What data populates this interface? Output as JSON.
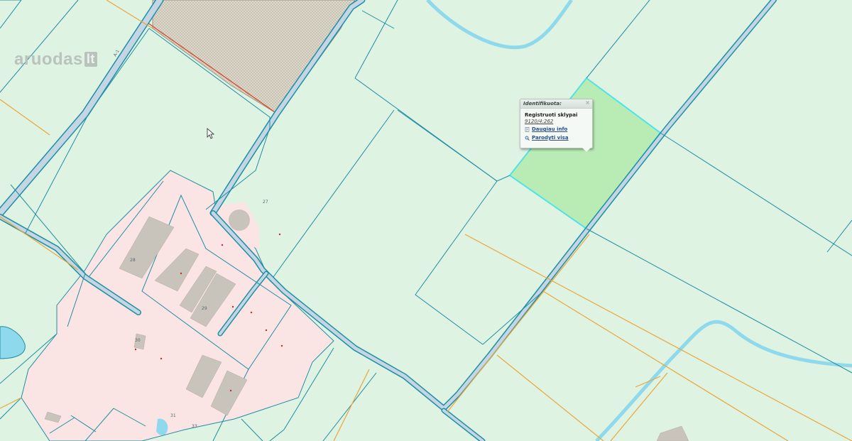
{
  "map": {
    "watermark": {
      "brand": "aruodas",
      "tld": "lt"
    },
    "road_labels": [
      "A-1"
    ],
    "lot_numbers": [
      "27",
      "28",
      "29",
      "30",
      "31",
      "33"
    ],
    "colors": {
      "background": "#dff3e3",
      "parcel_border": "#1f8ea3",
      "selected_fill": "#b9ecb4",
      "selected_border": "#4fe3e8",
      "orange_line": "#e8a63b",
      "red_line": "#d9472a",
      "road": "#b9d0e0",
      "water": "#8fd9ec",
      "industrial_fill": "#fbe4e4",
      "building": "#c9c4bb",
      "hatch_fill": "#d9d4c6"
    }
  },
  "popup": {
    "header": "Identifikuota:",
    "close_symbol": "×",
    "subtitle": "Registruoti sklypai",
    "parcel_id": "9120/4:262",
    "more_info_link": "Daugiau info",
    "show_all_link": "Parodyti visą"
  }
}
